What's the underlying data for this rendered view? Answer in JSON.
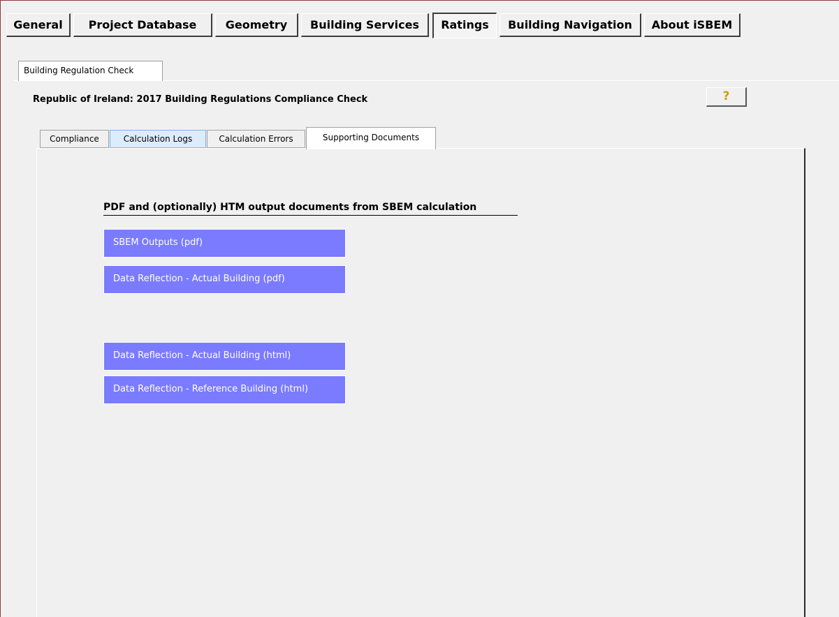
{
  "main_tabs": [
    {
      "label": "General"
    },
    {
      "label": "Project Database"
    },
    {
      "label": "Geometry"
    },
    {
      "label": "Building Services"
    },
    {
      "label": "Ratings"
    },
    {
      "label": "Building Navigation"
    },
    {
      "label": "About iSBEM"
    }
  ],
  "active_main_tab": "Ratings",
  "sub_tab": {
    "label": "Building Regulation Check"
  },
  "page_title": "Republic of Ireland: 2017 Building Regulations Compliance Check",
  "help_button": {
    "icon": "help-question-icon",
    "glyph": "?"
  },
  "inner_tabs": [
    {
      "label": "Compliance"
    },
    {
      "label": "Calculation Logs"
    },
    {
      "label": "Calculation Errors"
    },
    {
      "label": "Supporting Documents"
    }
  ],
  "active_inner_tab": "Supporting Documents",
  "section_heading": "PDF and (optionally) HTM output documents from SBEM calculation",
  "document_buttons": [
    {
      "label": "SBEM Outputs (pdf)"
    },
    {
      "label": "Data Reflection - Actual Building (pdf)"
    },
    {
      "label": "Data Reflection - Actual Building (html)"
    },
    {
      "label": "Data Reflection - Reference Building (html)"
    }
  ],
  "colors": {
    "button_bg": "#7b7bff",
    "window_bg": "#f0f0f0",
    "frame_border": "#8a3a3a"
  }
}
